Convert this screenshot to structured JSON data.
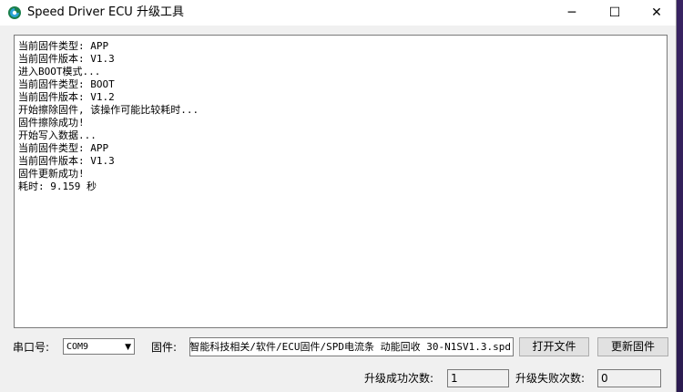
{
  "window": {
    "title": "Speed Driver ECU 升级工具",
    "icon": "app-icon",
    "controls": {
      "minimize": "─",
      "maximize": "☐",
      "close": "✕"
    }
  },
  "log": [
    "当前固件类型: APP",
    "当前固件版本: V1.3",
    "进入BOOT模式...",
    "当前固件类型: BOOT",
    "当前固件版本: V1.2",
    "开始擦除固件, 该操作可能比较耗时...",
    "固件擦除成功!",
    "开始写入数据...",
    "当前固件类型: APP",
    "当前固件版本: V1.3",
    "固件更新成功!",
    "耗时: 9.159 秒"
  ],
  "serial": {
    "label": "串口号:",
    "value": "COM9"
  },
  "firmware": {
    "label": "固件:",
    "path": "智能科技相关/软件/ECU固件/SPD电流条 动能回收 30-N1SV1.3.spd"
  },
  "buttons": {
    "open_file": "打开文件",
    "update_firmware": "更新固件"
  },
  "stats": {
    "success_label": "升级成功次数:",
    "success_count": "1",
    "fail_label": "升级失败次数:",
    "fail_count": "0"
  }
}
